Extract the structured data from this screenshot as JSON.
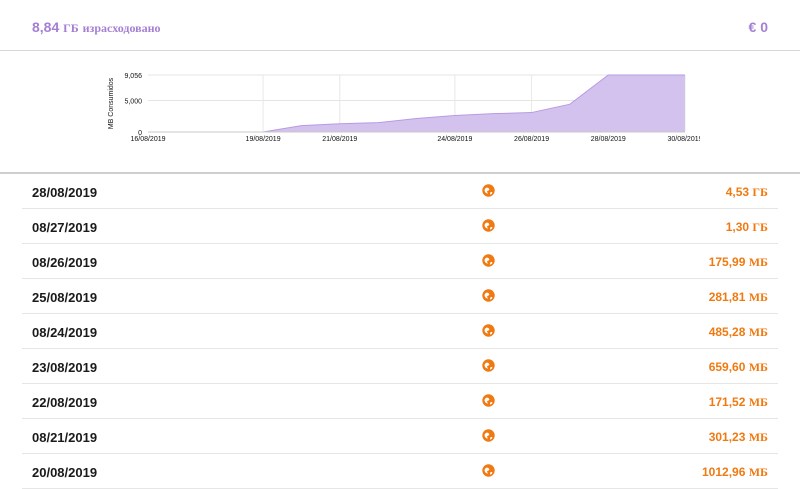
{
  "summary": {
    "used_value": "8,84",
    "used_unit": "ГБ",
    "used_label": "израсходовано",
    "cost": "€ 0",
    "accent_color": "#a57fd3"
  },
  "chart_data": {
    "type": "area",
    "ylabel": "MB Consumidos",
    "y_ticks": [
      "9,056",
      "5,000",
      "0"
    ],
    "y_tick_values": [
      9056,
      5000,
      0
    ],
    "ylim": [
      0,
      9056
    ],
    "x_tick_labels": [
      "16/08/2019",
      "19/08/2019",
      "21/08/2019",
      "24/08/2019",
      "26/08/2019",
      "28/08/2019",
      "30/08/2019"
    ],
    "x": [
      "16/08/2019",
      "17/08/2019",
      "18/08/2019",
      "19/08/2019",
      "20/08/2019",
      "21/08/2019",
      "22/08/2019",
      "23/08/2019",
      "24/08/2019",
      "25/08/2019",
      "26/08/2019",
      "27/08/2019",
      "28/08/2019",
      "29/08/2019",
      "30/08/2019"
    ],
    "values": [
      0,
      0,
      0,
      0,
      1013,
      1314,
      1486,
      2145,
      2631,
      2913,
      3089,
      4420,
      9056,
      9056,
      9056
    ],
    "grid": true,
    "fill_color": "#d4c2ee",
    "line_color": "#b79ae3"
  },
  "rows": [
    {
      "date": "28/08/2019",
      "value": "4,53",
      "unit": "ГБ",
      "network_icon": "globe-icon"
    },
    {
      "date": "08/27/2019",
      "value": "1,30",
      "unit": "ГБ",
      "network_icon": "globe-icon"
    },
    {
      "date": "08/26/2019",
      "value": "175,99",
      "unit": "МБ",
      "network_icon": "globe-icon"
    },
    {
      "date": "25/08/2019",
      "value": "281,81",
      "unit": "МБ",
      "network_icon": "globe-icon"
    },
    {
      "date": "08/24/2019",
      "value": "485,28",
      "unit": "МБ",
      "network_icon": "globe-icon"
    },
    {
      "date": "23/08/2019",
      "value": "659,60",
      "unit": "МБ",
      "network_icon": "globe-icon"
    },
    {
      "date": "22/08/2019",
      "value": "171,52",
      "unit": "МБ",
      "network_icon": "globe-icon"
    },
    {
      "date": "08/21/2019",
      "value": "301,23",
      "unit": "МБ",
      "network_icon": "globe-icon"
    },
    {
      "date": "20/08/2019",
      "value": "1012,96",
      "unit": "МБ",
      "network_icon": "globe-icon"
    }
  ],
  "colors": {
    "value_color": "#f07a11",
    "icon_color": "#f07a11"
  }
}
